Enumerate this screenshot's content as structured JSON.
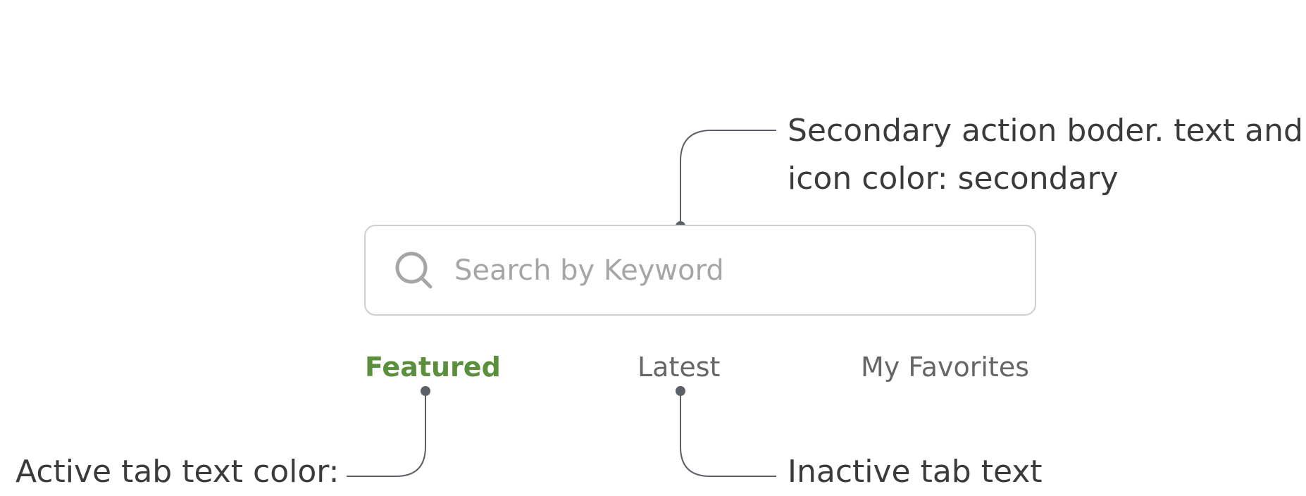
{
  "search": {
    "placeholder": "Search by Keyword",
    "icon": "search-icon"
  },
  "tabs": [
    {
      "label": "Featured",
      "state": "active"
    },
    {
      "label": "Latest",
      "state": "inactive"
    },
    {
      "label": "My Favorites",
      "state": "inactive"
    }
  ],
  "annotations": {
    "secondary": {
      "line1": "Secondary action boder. text and",
      "line2": "icon color: secondary"
    },
    "active_tab": "Active tab text color:",
    "inactive_tab": "Inactive tab text"
  },
  "colors": {
    "active_tab": "#5a8f3c",
    "inactive_tab": "#666666",
    "secondary": "#a6a6a6",
    "search_border": "#cfcfcf",
    "leader_line": "#5b5f66",
    "annotation_text": "#3b3b3b"
  }
}
